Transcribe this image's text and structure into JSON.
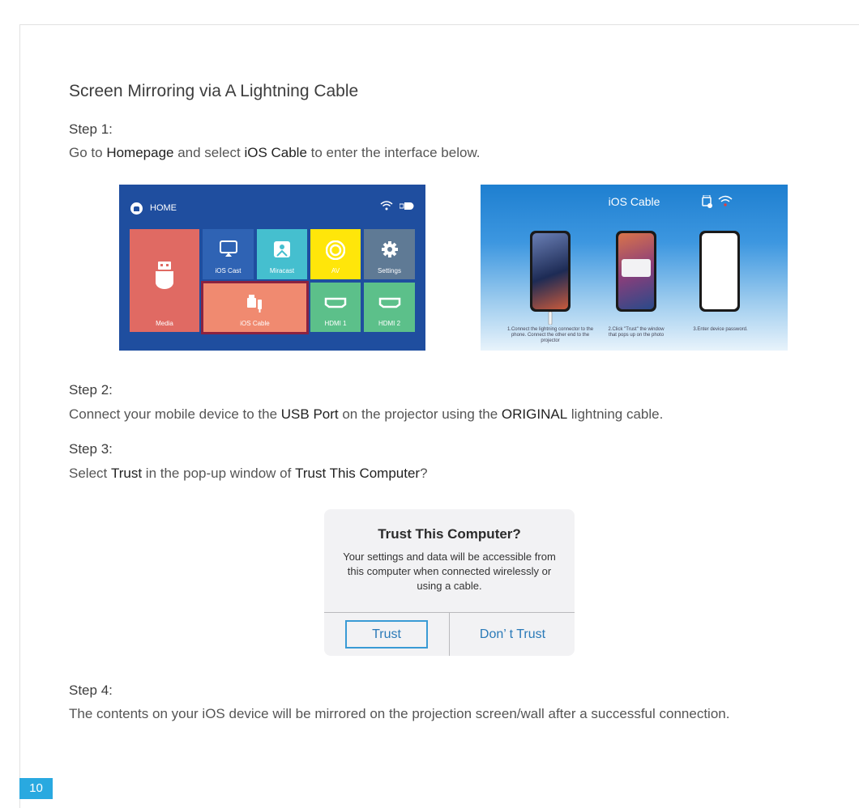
{
  "section_title": "Screen Mirroring via A Lightning Cable",
  "step1": {
    "heading": "Step 1:",
    "pre": "Go to ",
    "b1": "Homepage",
    "mid": " and select ",
    "b2": "iOS Cable",
    "post": " to enter the interface below."
  },
  "home_screen": {
    "title": "HOME",
    "tiles": {
      "media": "Media",
      "ios_cast": "iOS Cast",
      "miracast": "Miracast",
      "av": "AV",
      "settings": "Settings",
      "ios_cable": "iOS Cable",
      "hdmi1": "HDMI 1",
      "hdmi2": "HDMI 2"
    },
    "colors": {
      "background": "#1f4e9f",
      "media": "#e06a63",
      "ios_cast": "#2f63b4",
      "miracast": "#45bfcf",
      "av": "#ffe60a",
      "settings": "#5f7a95",
      "ios_cable": "#f08a70",
      "hdmi": "#5cc08a",
      "highlight": "#8b2240"
    }
  },
  "ios_cable_screen": {
    "title": "iOS Cable",
    "captions": [
      "1.Connect the lightning connector to the phone. Connect the other end to the projector",
      "2.Click \"Trust\" the window that pops up on the photo",
      "3.Enter device password."
    ]
  },
  "step2": {
    "heading": "Step 2:",
    "pre": "Connect your mobile device to the ",
    "b1": "USB Port",
    "mid": " on the projector using the ",
    "b2": "ORIGINAL",
    "post": " lightning cable."
  },
  "step3": {
    "heading": "Step 3:",
    "pre": "Select ",
    "b1": "Trust",
    "mid": " in the pop-up window of ",
    "b2": "Trust This Computer",
    "post": "?"
  },
  "dialog": {
    "title": "Trust This Computer?",
    "body": "Your settings and data will be accessible from this computer when connected wirelessly or using a cable.",
    "trust_label": "Trust",
    "dont_trust_label": "Don’ t Trust"
  },
  "step4": {
    "heading": "Step 4:",
    "text": "The contents on your iOS device will be mirrored on the projection screen/wall after a successful connection."
  },
  "page_number": "10"
}
